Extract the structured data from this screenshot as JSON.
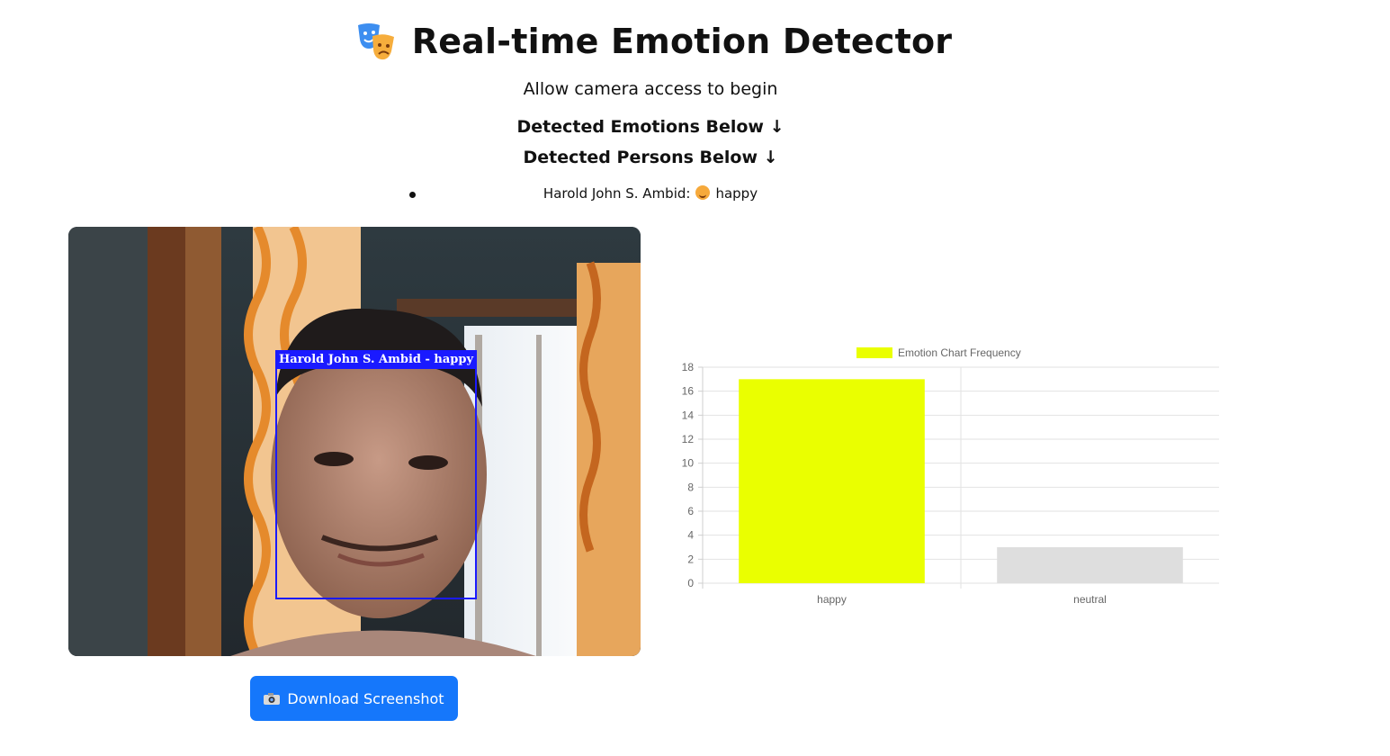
{
  "header": {
    "title": "Real-time Emotion Detector",
    "subtitle": "Allow camera access to begin",
    "emotions_heading": "Detected Emotions Below ↓",
    "persons_heading": "Detected Persons Below ↓",
    "masks_icon": "theater-masks-icon"
  },
  "persons": [
    {
      "name": "Harold John S. Ambid:",
      "emoji": "smiling-face-icon",
      "emotion": "happy"
    }
  ],
  "video": {
    "overlay_label": "Harold John S. Ambid - happy",
    "box_color": "#1a1aff"
  },
  "actions": {
    "download_label": "Download Screenshot",
    "download_icon": "camera-icon",
    "button_color": "#1577fb"
  },
  "chart_data": {
    "type": "bar",
    "categories": [
      "happy",
      "neutral"
    ],
    "series": [
      {
        "name": "Emotion Chart Frequency",
        "values": [
          17,
          3
        ],
        "colors": [
          "#eaff00",
          "#dedede"
        ]
      }
    ],
    "legend_color": "#eaff00",
    "ylim": [
      0,
      18
    ],
    "yticks": [
      0,
      2,
      4,
      6,
      8,
      10,
      12,
      14,
      16,
      18
    ],
    "grid": true,
    "legend_position": "top"
  }
}
